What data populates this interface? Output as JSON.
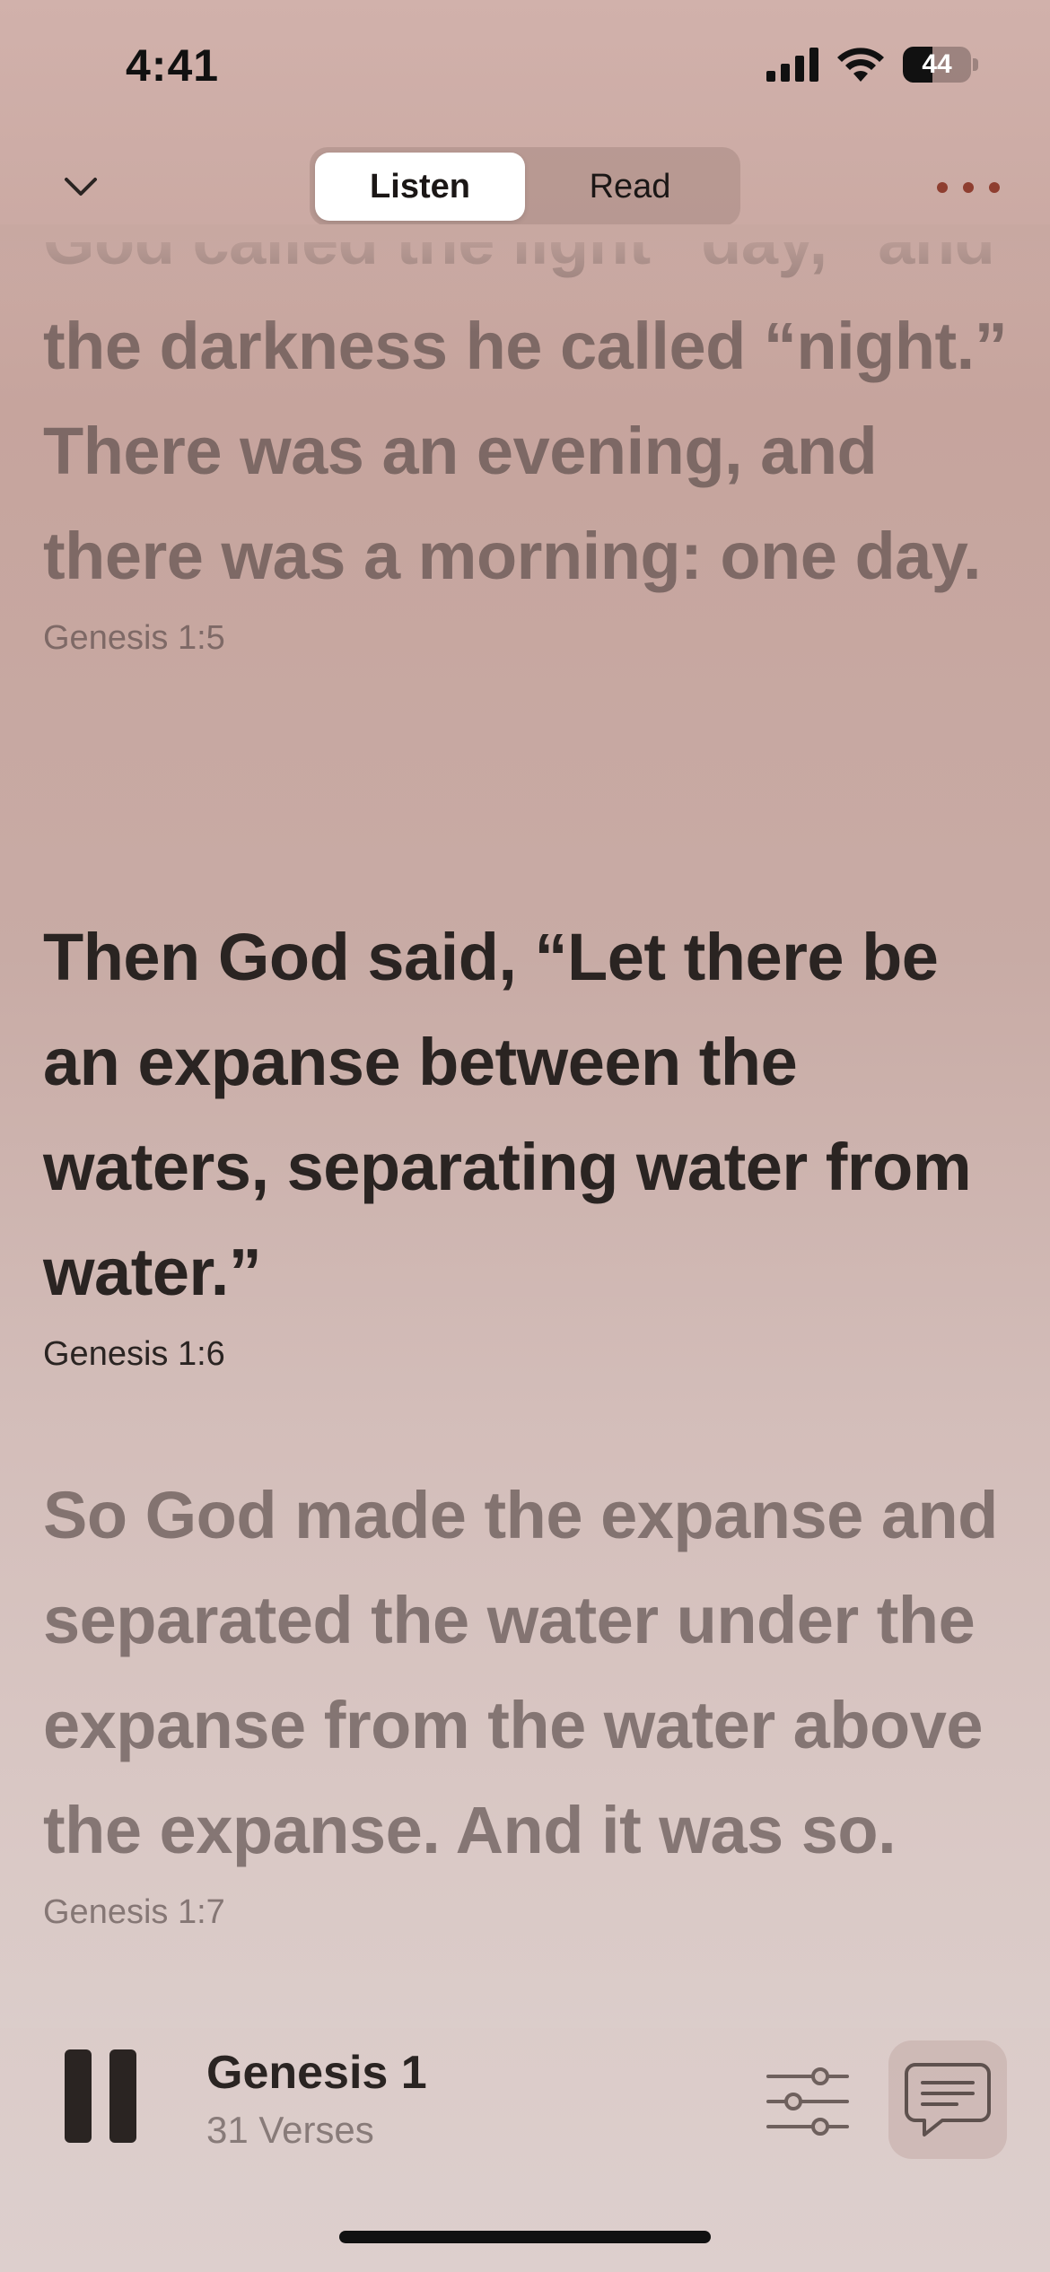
{
  "status_bar": {
    "time": "4:41",
    "battery_level": "44",
    "battery_fraction": 0.44,
    "signal_bars": 4
  },
  "nav": {
    "tabs": [
      {
        "label": "Listen",
        "active": true
      },
      {
        "label": "Read",
        "active": false
      }
    ]
  },
  "verses": [
    {
      "text": "God called the light “day,” and the darkness he called “night.” There was an evening, and there was a morning: one day.",
      "reference": "Genesis 1:5",
      "state": "dim"
    },
    {
      "text": "Then God said, “Let there be an expanse between the waters, separating water from water.”",
      "reference": "Genesis 1:6",
      "state": "active"
    },
    {
      "text": "So God made the expanse and separated the water under the expanse from the water above the expanse. And it was so.",
      "reference": "Genesis 1:7",
      "state": "dim"
    }
  ],
  "player": {
    "title": "Genesis 1",
    "subtitle": "31 Verses",
    "state": "playing"
  },
  "icons": {
    "collapse": "chevron-down-icon",
    "more": "more-dots-icon",
    "pause": "pause-icon",
    "settings": "sliders-icon",
    "chat": "chat-bubble-icon"
  },
  "colors": {
    "accent": "#8e3e30",
    "active_text": "#2a2422",
    "background_top": "#d1b1ab",
    "background_bottom": "#ddcfcd"
  }
}
